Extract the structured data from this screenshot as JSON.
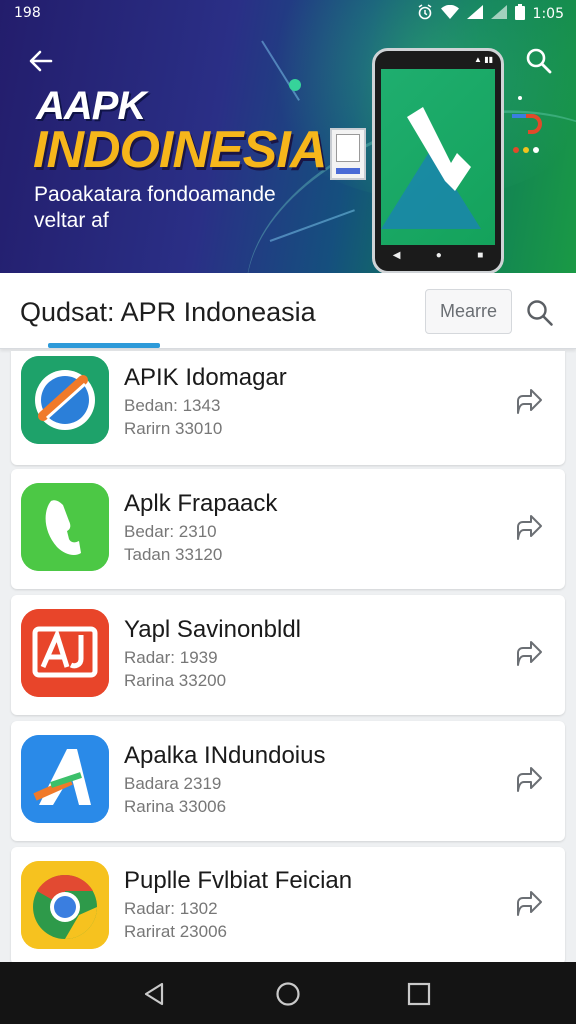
{
  "status": {
    "left_text": "198",
    "time": "1:05"
  },
  "hero": {
    "brand_line1": "AAPK",
    "brand_line2": "INDOINESIA",
    "tagline": "Paoakatara fondoamande veltar af"
  },
  "search": {
    "query_label": "Qudsat: APR Indoneasia",
    "more_label": "Mearre"
  },
  "apps": [
    {
      "name": "APIK Idomagar",
      "line1": "Bedan: 1343",
      "line2": "Rarirn 33010",
      "icon": "shield-blue-icon",
      "color": "#1ea26a"
    },
    {
      "name": "Aplk Frapaack",
      "line1": "Bedar: 2310",
      "line2": "Tadan 33120",
      "icon": "phone-leaf-icon",
      "color": "#4cc845"
    },
    {
      "name": "Yapl Savinonbldl",
      "line1": "Radar: 1939",
      "line2": "Rarina 33200",
      "icon": "aj-letters-icon",
      "color": "#e8452a"
    },
    {
      "name": "Apalka INdundoius",
      "line1": "Badara 2319",
      "line2": "Rarina 33006",
      "icon": "a-letter-icon",
      "color": "#2a8ae8"
    },
    {
      "name": "Puplle Fvlbiat Feician",
      "line1": "Radar: 1302",
      "line2": "Rarirat 23006",
      "icon": "chrome-icon",
      "color": "#f6c21f"
    }
  ]
}
